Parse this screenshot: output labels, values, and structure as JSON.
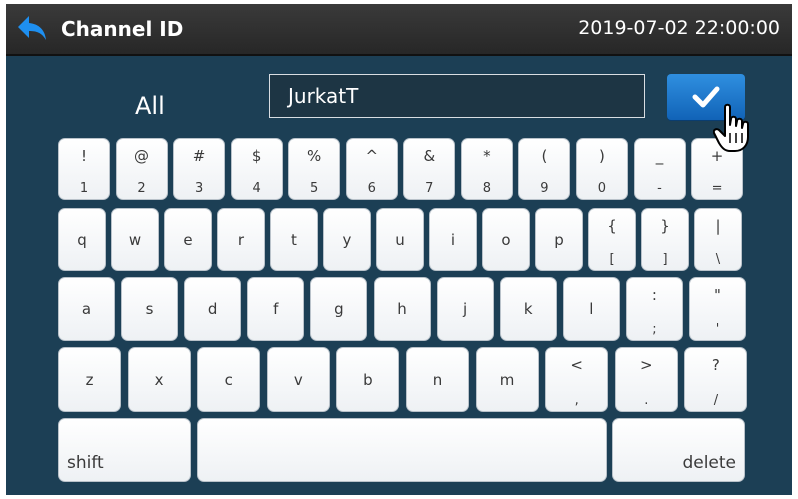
{
  "header": {
    "title": "Channel ID",
    "datetime": "2019-07-02  22:00:00",
    "back_icon": "back-arrow-icon"
  },
  "input": {
    "mode_label": "All",
    "value": "JurkatT"
  },
  "confirm": {
    "icon": "checkmark-icon",
    "color": "#1a78d0"
  },
  "keyboard": {
    "row1": [
      {
        "top": "!",
        "bottom": "1"
      },
      {
        "top": "@",
        "bottom": "2"
      },
      {
        "top": "#",
        "bottom": "3"
      },
      {
        "top": "$",
        "bottom": "4"
      },
      {
        "top": "%",
        "bottom": "5"
      },
      {
        "top": "^",
        "bottom": "6"
      },
      {
        "top": "&",
        "bottom": "7"
      },
      {
        "top": "*",
        "bottom": "8"
      },
      {
        "top": "(",
        "bottom": "9"
      },
      {
        "top": ")",
        "bottom": "0"
      },
      {
        "top": "_",
        "bottom": "-"
      },
      {
        "top": "+",
        "bottom": "="
      }
    ],
    "row2": [
      {
        "main": "q"
      },
      {
        "main": "w"
      },
      {
        "main": "e"
      },
      {
        "main": "r"
      },
      {
        "main": "t"
      },
      {
        "main": "y"
      },
      {
        "main": "u"
      },
      {
        "main": "i"
      },
      {
        "main": "o"
      },
      {
        "main": "p"
      },
      {
        "top": "{",
        "bottom": "["
      },
      {
        "top": "}",
        "bottom": "]"
      },
      {
        "top": "|",
        "bottom": "\\"
      }
    ],
    "row3": [
      {
        "main": "a"
      },
      {
        "main": "s"
      },
      {
        "main": "d"
      },
      {
        "main": "f"
      },
      {
        "main": "g"
      },
      {
        "main": "h"
      },
      {
        "main": "j"
      },
      {
        "main": "k"
      },
      {
        "main": "l"
      },
      {
        "top": ":",
        "bottom": ";"
      },
      {
        "top": "\"",
        "bottom": "'"
      }
    ],
    "row4": [
      {
        "main": "z"
      },
      {
        "main": "x"
      },
      {
        "main": "c"
      },
      {
        "main": "v"
      },
      {
        "main": "b"
      },
      {
        "main": "n"
      },
      {
        "main": "m"
      },
      {
        "top": "<",
        "bottom": ","
      },
      {
        "top": ">",
        "bottom": "."
      },
      {
        "top": "?",
        "bottom": "/"
      }
    ],
    "shift_label": "shift",
    "space_label": "",
    "delete_label": "delete"
  }
}
